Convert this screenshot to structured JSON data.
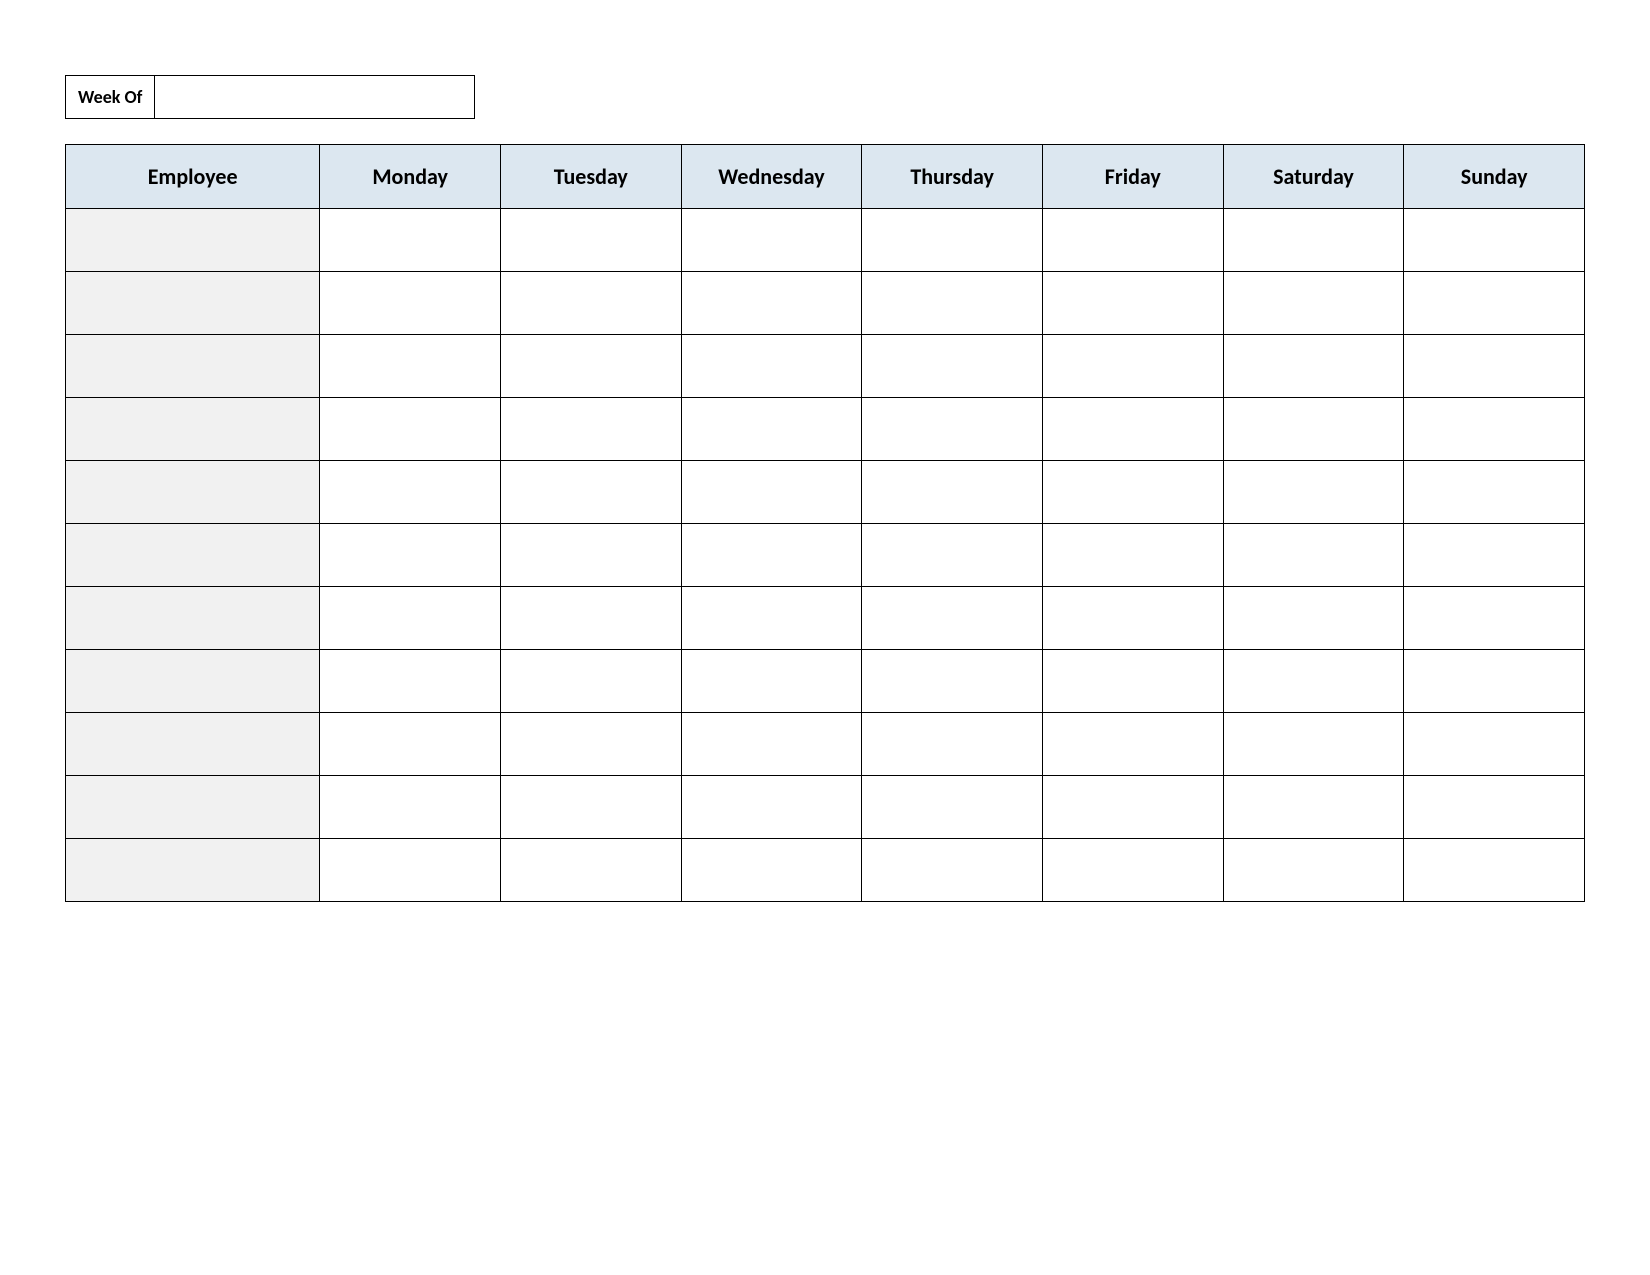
{
  "week_of": {
    "label": "Week Of",
    "value": ""
  },
  "table": {
    "headers": {
      "employee": "Employee",
      "days": [
        "Monday",
        "Tuesday",
        "Wednesday",
        "Thursday",
        "Friday",
        "Saturday",
        "Sunday"
      ]
    },
    "rows": [
      {
        "employee": "",
        "cells": [
          "",
          "",
          "",
          "",
          "",
          "",
          ""
        ]
      },
      {
        "employee": "",
        "cells": [
          "",
          "",
          "",
          "",
          "",
          "",
          ""
        ]
      },
      {
        "employee": "",
        "cells": [
          "",
          "",
          "",
          "",
          "",
          "",
          ""
        ]
      },
      {
        "employee": "",
        "cells": [
          "",
          "",
          "",
          "",
          "",
          "",
          ""
        ]
      },
      {
        "employee": "",
        "cells": [
          "",
          "",
          "",
          "",
          "",
          "",
          ""
        ]
      },
      {
        "employee": "",
        "cells": [
          "",
          "",
          "",
          "",
          "",
          "",
          ""
        ]
      },
      {
        "employee": "",
        "cells": [
          "",
          "",
          "",
          "",
          "",
          "",
          ""
        ]
      },
      {
        "employee": "",
        "cells": [
          "",
          "",
          "",
          "",
          "",
          "",
          ""
        ]
      },
      {
        "employee": "",
        "cells": [
          "",
          "",
          "",
          "",
          "",
          "",
          ""
        ]
      },
      {
        "employee": "",
        "cells": [
          "",
          "",
          "",
          "",
          "",
          "",
          ""
        ]
      },
      {
        "employee": "",
        "cells": [
          "",
          "",
          "",
          "",
          "",
          "",
          ""
        ]
      }
    ]
  }
}
